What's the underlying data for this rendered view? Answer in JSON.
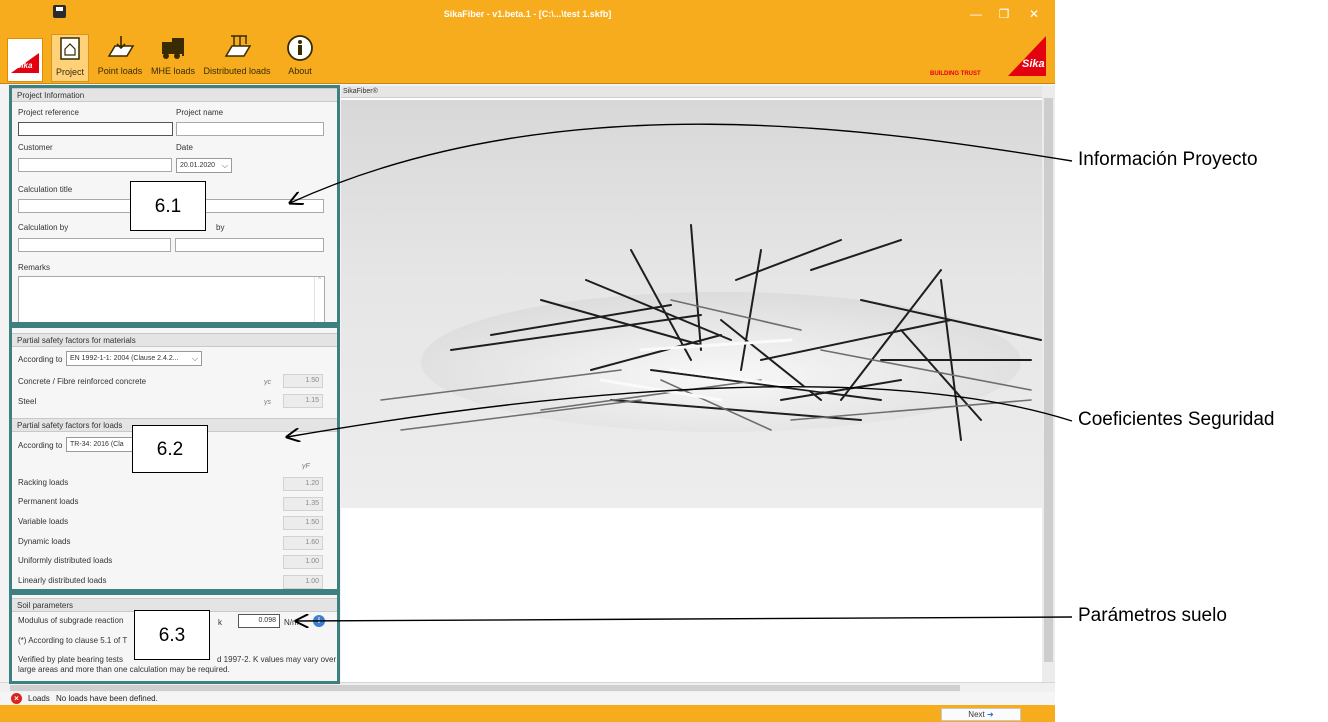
{
  "window": {
    "title": "SikaFiber - v1.beta.1 - [C:\\...\\test 1.skfb]",
    "minimize": "—",
    "restore": "❐",
    "close": "✕"
  },
  "ribbon": {
    "items": [
      {
        "label": "Project",
        "icon": "project-icon"
      },
      {
        "label": "Point loads",
        "icon": "point-loads-icon"
      },
      {
        "label": "MHE loads",
        "icon": "forklift-icon"
      },
      {
        "label": "Distributed loads",
        "icon": "distributed-loads-icon"
      },
      {
        "label": "About",
        "icon": "info-icon"
      }
    ],
    "brand_tagline": "BUILDING TRUST",
    "brand_word": "Sika"
  },
  "project_info": {
    "heading": "Project Information",
    "project_reference_label": "Project reference",
    "project_name_label": "Project name",
    "customer_label": "Customer",
    "date_label": "Date",
    "date_value": "20.01.2020",
    "calculation_title_label": "Calculation title",
    "calculation_by_label": "Calculation by",
    "checked_by_label": "by",
    "remarks_label": "Remarks"
  },
  "materials": {
    "heading": "Partial safety factors for materials",
    "according_label": "According to",
    "standard": "EN 1992-1-1: 2004 (Clause 2.4.2...",
    "rows": [
      {
        "label": "Concrete / Fibre reinforced concrete",
        "symbol": "γc",
        "value": "1.50"
      },
      {
        "label": "Steel",
        "symbol": "γs",
        "value": "1.15"
      }
    ]
  },
  "loads": {
    "heading": "Partial safety factors for loads",
    "according_label": "According to",
    "standard": "TR-34: 2016 (Cla",
    "symbol_header": "γF",
    "rows": [
      {
        "label": "Racking loads",
        "value": "1.20"
      },
      {
        "label": "Permanent loads",
        "value": "1.35"
      },
      {
        "label": "Variable loads",
        "value": "1.50"
      },
      {
        "label": "Dynamic loads",
        "value": "1.60"
      },
      {
        "label": "Uniformly distributed loads",
        "value": "1.00"
      },
      {
        "label": "Linearly distributed loads",
        "value": "1.00"
      }
    ]
  },
  "soil": {
    "heading": "Soil parameters",
    "modulus_label": "Modulus of subgrade reaction",
    "k_label": "k",
    "k_value": "0.098",
    "k_unit": "N/m",
    "note1": "(*) According to clause 5.1 of T",
    "note2a": "Verified by plate bearing tests",
    "note2b": "d 1997-2. K values may vary over",
    "note3": "large areas and more than one calculation may be required."
  },
  "content": {
    "header": "SikaFiber®"
  },
  "status": {
    "tag": "Loads",
    "message": "No loads have been defined."
  },
  "footer": {
    "next_label": "Next"
  },
  "callouts": {
    "c1": "6.1",
    "c2": "6.2",
    "c3": "6.3"
  },
  "annotations": {
    "a1": "Información Proyecto",
    "a2": "Coeficientes Seguridad",
    "a3": "Parámetros suelo"
  },
  "colors": {
    "ribbon": "#f7ac1e",
    "frame": "#3e7f7f",
    "sika_red": "#e3000f"
  }
}
